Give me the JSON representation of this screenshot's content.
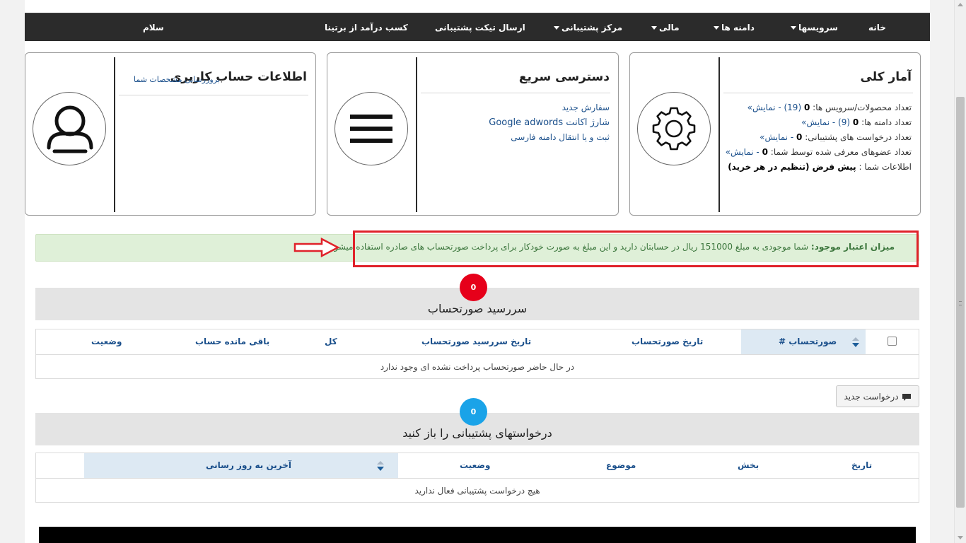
{
  "nav": {
    "home": "خانه",
    "services": "سرویسها",
    "domains": "دامنه ها",
    "finance": "مالی",
    "support_center": "مرکز پشتیبانی",
    "send_ticket": "ارسال تیکت پشتیبانی",
    "affiliate": "کسب درآمد از برتینا",
    "greeting": "سلام"
  },
  "stats_panel": {
    "title": "آمار کلی",
    "icon": "gear-icon",
    "products_label": "تعداد محصولات/سرویس ها:",
    "products_value": "0",
    "products_extra": "(19) - نمایش»",
    "domains_label": "تعداد دامنه ها:",
    "domains_value": "0",
    "domains_extra": "(9) - نمایش»",
    "tickets_label": "تعداد درخواست های پشتیبانی:",
    "tickets_value": "0",
    "tickets_extra": "- نمایش»",
    "referrals_label": "تعداد عضوهای معرفی شده توسط شما:",
    "referrals_value": "0",
    "referrals_extra": "- نمایش»",
    "info_label": "اطلاعات شما :",
    "info_value": "پیش فرض (تنظیم در هر خرید)"
  },
  "quick_panel": {
    "title": "دسترسی سریع",
    "icon": "menu-icon",
    "links": [
      "سفارش جدید",
      "شارژ اکانت Google adwords",
      "ثبت و یا انتقال دامنه فارسی"
    ]
  },
  "account_panel": {
    "title": "اطلاعات حساب کاربری",
    "update_link": "بروزرسانی مشخصات شما",
    "icon": "user-icon"
  },
  "credit_alert": {
    "label": "میزان اعتبار موجود:",
    "message": "شما موجودی به مبلغ 151000 ریال در حسابتان دارید و این مبلغ به صورت خودکار برای پرداخت صورتحساب های صادره استفاده میشود"
  },
  "invoices": {
    "badge": "0",
    "title": "سررسید صورتحساب",
    "columns": [
      "صورتحساب #",
      "تاریخ صورتحساب",
      "تاریخ سررسید صورتحساب",
      "کل",
      "باقی مانده حساب",
      "وضعیت"
    ],
    "empty": "در حال حاضر صورتحساب پرداخت نشده ای وجود ندارد"
  },
  "new_request_button": "درخواست جدید",
  "tickets": {
    "badge": "0",
    "title": "درخواستهای پشتیبانی را باز کنید",
    "columns": [
      "تاریخ",
      "بخش",
      "موضوع",
      "وضعیت",
      "آخرین به روز رسانی"
    ],
    "empty": "هیچ درخواست پشتیبانی فعال ندارید"
  },
  "colors": {
    "navbar": "#2b2b2b",
    "alert_bg": "#dff0d8",
    "alert_text": "#3c763d",
    "highlight": "#e0222a",
    "badge_red": "#e6001a",
    "badge_blue": "#1aa3e8",
    "link": "#1a4f8b"
  }
}
